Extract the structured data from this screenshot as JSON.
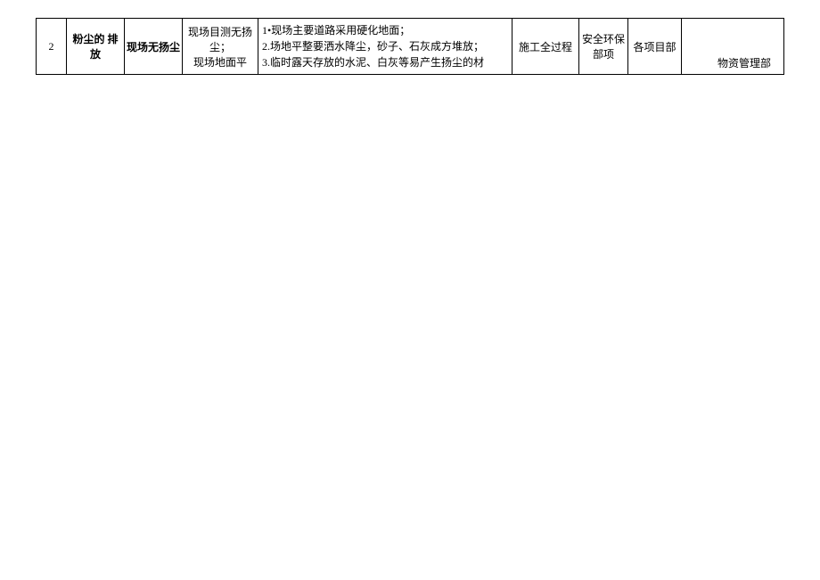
{
  "row": {
    "num": "2",
    "item": "粉尘的 排放",
    "goal": "现场无扬尘",
    "method": "现场目测无扬尘；\n现场地面平",
    "measures_1": "1•现场主要道路采用硬化地面；",
    "measures_2": "2.场地平整要洒水降尘，砂子、石灰成方堆放；",
    "measures_3": "3.临时露天存放的水泥、白灰等易产生扬尘的材",
    "phase": "施工全过程",
    "dept": "安全环保部项",
    "proj": "各项目部",
    "mgmt": "物资管理部"
  }
}
